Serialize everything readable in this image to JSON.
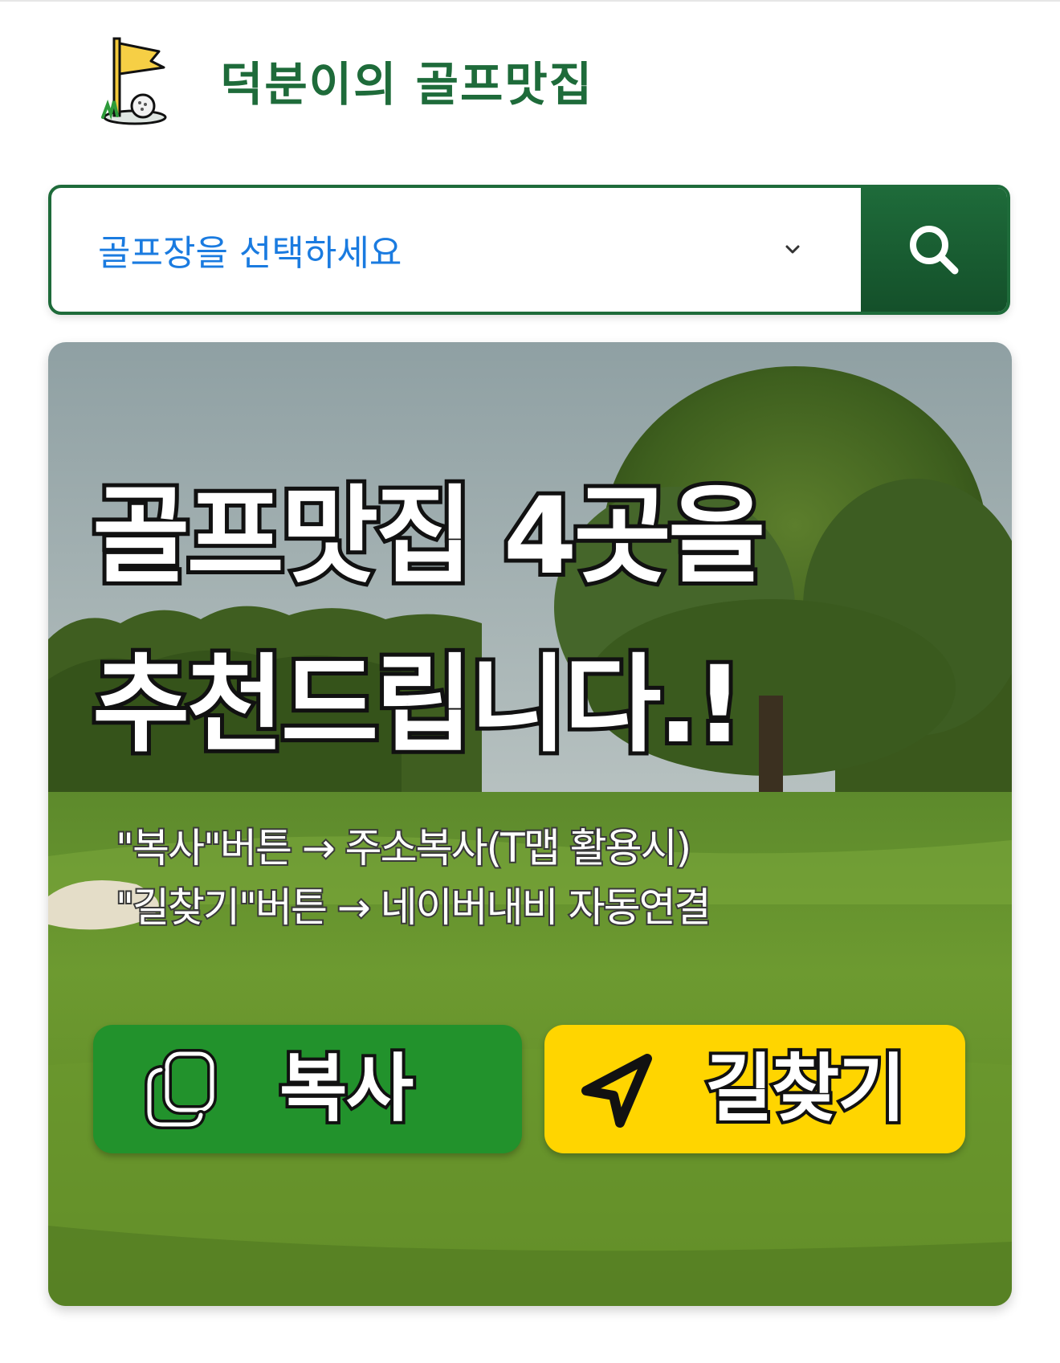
{
  "header": {
    "site_title": "덕분이의 골프맛집"
  },
  "search": {
    "select_placeholder": "골프장을 선택하세요"
  },
  "banner": {
    "headline_line1": "골프맛집 4곳을",
    "headline_line2": "추천드립니다.!",
    "sub_line1": "\"복사\"버튼 → 주소복사(T맵 활용시)",
    "sub_line2": "\"길찾기\"버튼 → 네이버내비 자동연결",
    "copy_label": "복사",
    "nav_label": "길찾기"
  },
  "colors": {
    "brand_green": "#1e6b3a",
    "placeholder_blue": "#1a7be0",
    "copy_button_green": "#22922c",
    "nav_button_yellow": "#ffd500"
  },
  "icons": {
    "logo": "golf-flag-icon",
    "chevron": "chevron-down-icon",
    "search": "search-icon",
    "copy": "copy-icon",
    "nav": "navigation-arrow-icon"
  }
}
